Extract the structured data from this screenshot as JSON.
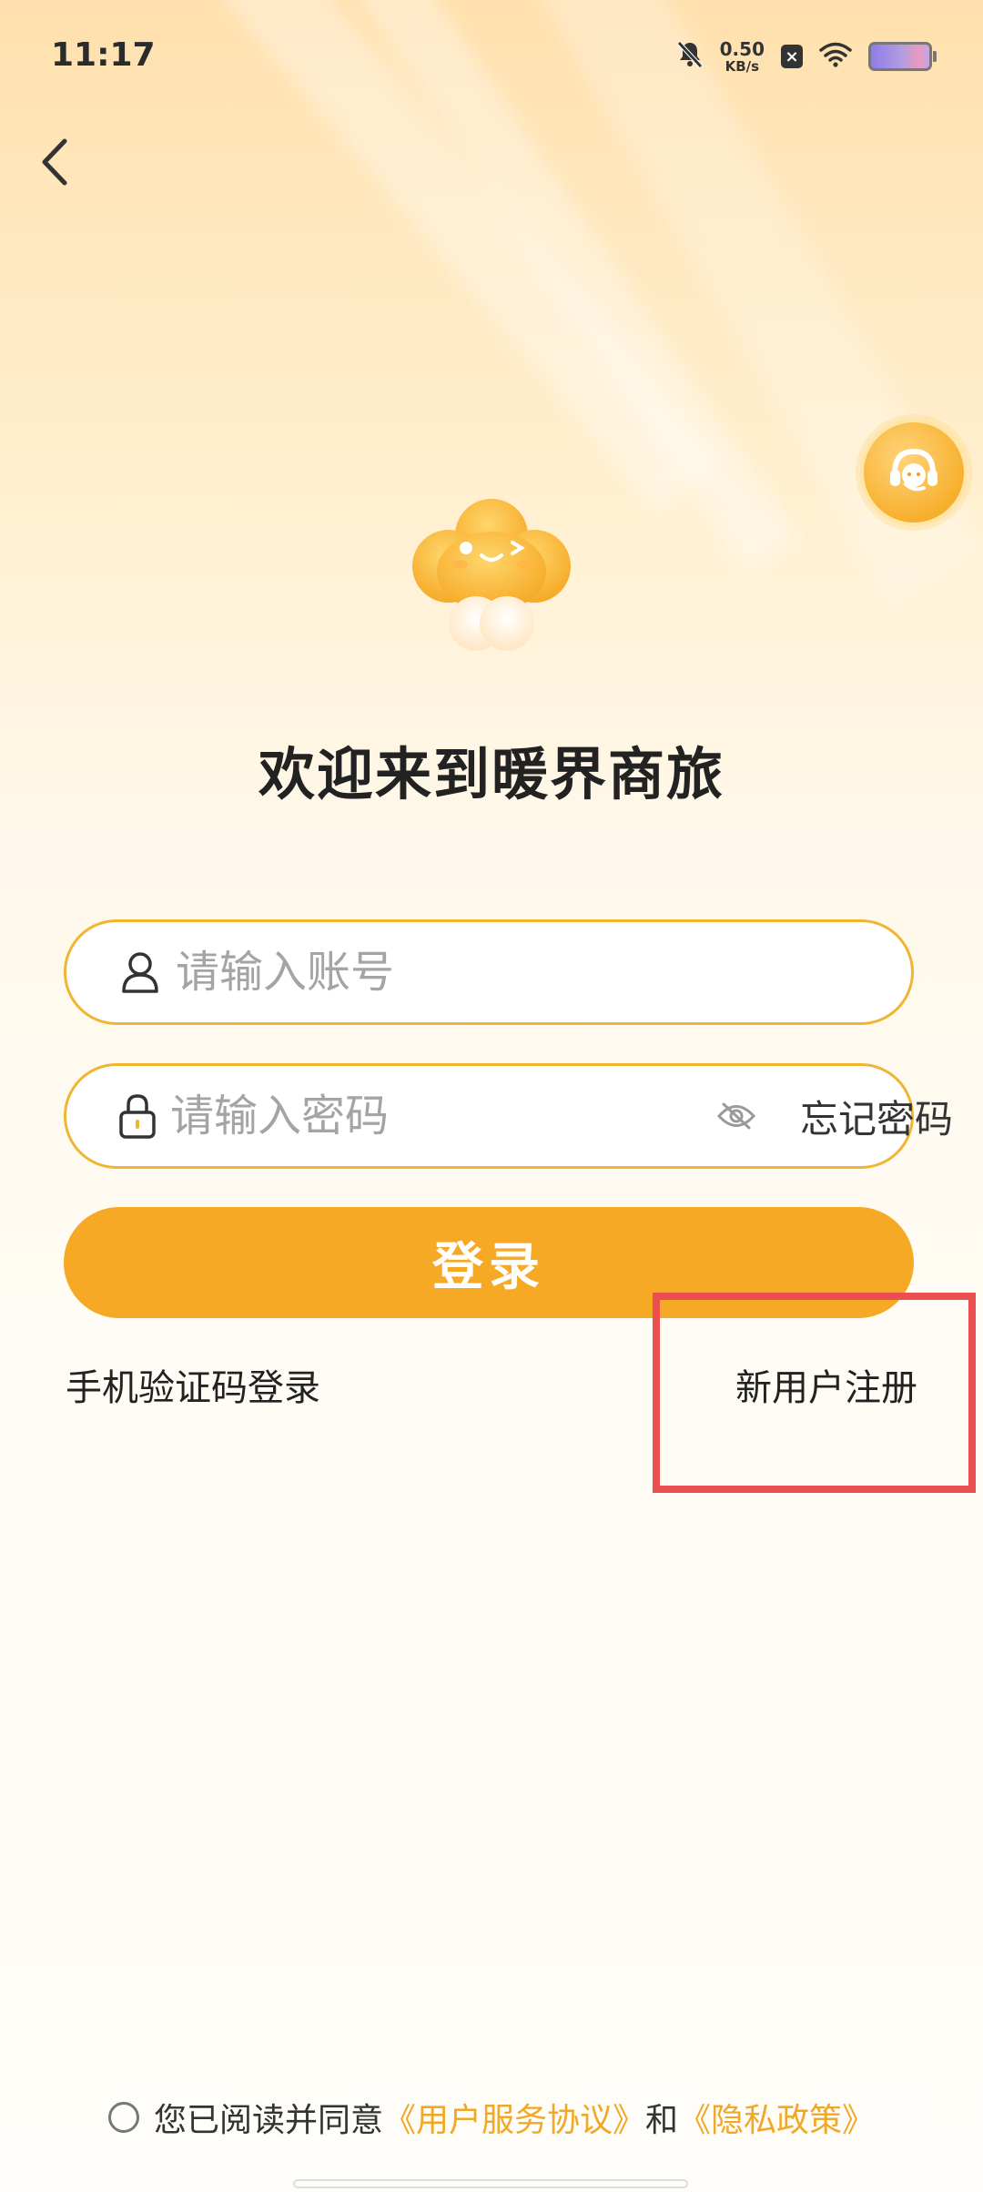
{
  "status_bar": {
    "time": "11:17",
    "net_speed_value": "0.50",
    "net_speed_unit": "KB/s",
    "x_badge": "×"
  },
  "icons": {
    "back": "chevron-left-icon",
    "support": "customer-service-icon",
    "account": "user-icon",
    "password": "lock-icon",
    "toggle_visibility": "eye-off-icon"
  },
  "page": {
    "title": "欢迎来到暖界商旅"
  },
  "form": {
    "account_placeholder": "请输入账号",
    "password_placeholder": "请输入密码",
    "forgot_password": "忘记密码",
    "login_label": "登录"
  },
  "links": {
    "sms_login": "手机验证码登录",
    "register": "新用户注册"
  },
  "agreement": {
    "prefix": "您已阅读并同意",
    "user_agreement": "《用户服务协议》",
    "conjunction": "和",
    "privacy_policy": "《隐私政策》"
  },
  "colors": {
    "accent": "#f6a925",
    "field_border": "#efb533",
    "highlight": "#ec4f4f"
  }
}
